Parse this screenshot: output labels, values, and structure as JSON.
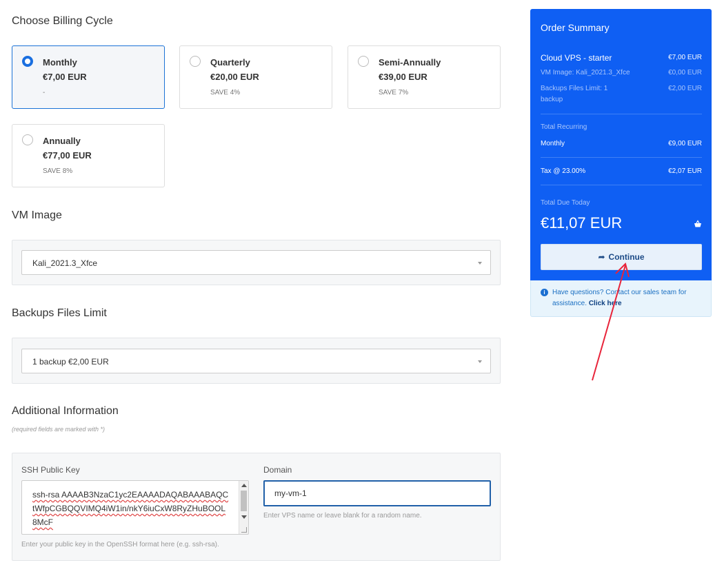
{
  "billing": {
    "heading": "Choose Billing Cycle",
    "options": [
      {
        "name": "Monthly",
        "price": "€7,00 EUR",
        "save": "-"
      },
      {
        "name": "Quarterly",
        "price": "€20,00 EUR",
        "save": "SAVE 4%"
      },
      {
        "name": "Semi-Annually",
        "price": "€39,00 EUR",
        "save": "SAVE 7%"
      },
      {
        "name": "Annually",
        "price": "€77,00 EUR",
        "save": "SAVE 8%"
      }
    ],
    "selected": "Monthly"
  },
  "vm_image": {
    "heading": "VM Image",
    "value": "Kali_2021.3_Xfce"
  },
  "backups": {
    "heading": "Backups Files Limit",
    "value": "1 backup €2,00 EUR"
  },
  "additional": {
    "heading": "Additional Information",
    "required_note": "(required fields are marked with *)",
    "ssh": {
      "label": "SSH Public Key",
      "value": "ssh-rsa AAAAB3NzaC1yc2EAAAADAQABAAABAQCtWfpCGBQQVIMQ4iW1in/nkY6iuCxW8RyZHuBOOL8McF",
      "hint": "Enter your public key in the OpenSSH format here (e.g. ssh-rsa)."
    },
    "domain": {
      "label": "Domain",
      "value": "my-vm-1",
      "hint": "Enter VPS name or leave blank for a random name."
    }
  },
  "summary": {
    "title": "Order Summary",
    "product": {
      "name": "Cloud VPS - starter",
      "price": "€7,00 EUR"
    },
    "lines": [
      {
        "label": "VM Image: Kali_2021.3_Xfce",
        "price": "€0,00 EUR"
      },
      {
        "label": "Backups Files Limit: 1 backup",
        "price": "€2,00 EUR"
      }
    ],
    "recurring_label": "Total Recurring",
    "recurring": {
      "label": "Monthly",
      "price": "€9,00 EUR"
    },
    "tax": {
      "label": "Tax @ 23.00%",
      "price": "€2,07 EUR"
    },
    "due_label": "Total Due Today",
    "due_total": "€11,07 EUR",
    "continue_label": "Continue"
  },
  "help": {
    "text": "Have questions? Contact our sales team for assistance.",
    "link": "Click here"
  },
  "colors": {
    "summary_bg": "#0f5ff3",
    "selected_border": "#1a72d6",
    "annotation_arrow": "#e8243a"
  },
  "icons": [
    "radio-selected",
    "radio-unselected",
    "dropdown-arrow",
    "cart-icon",
    "share-arrow-icon",
    "info-icon"
  ]
}
